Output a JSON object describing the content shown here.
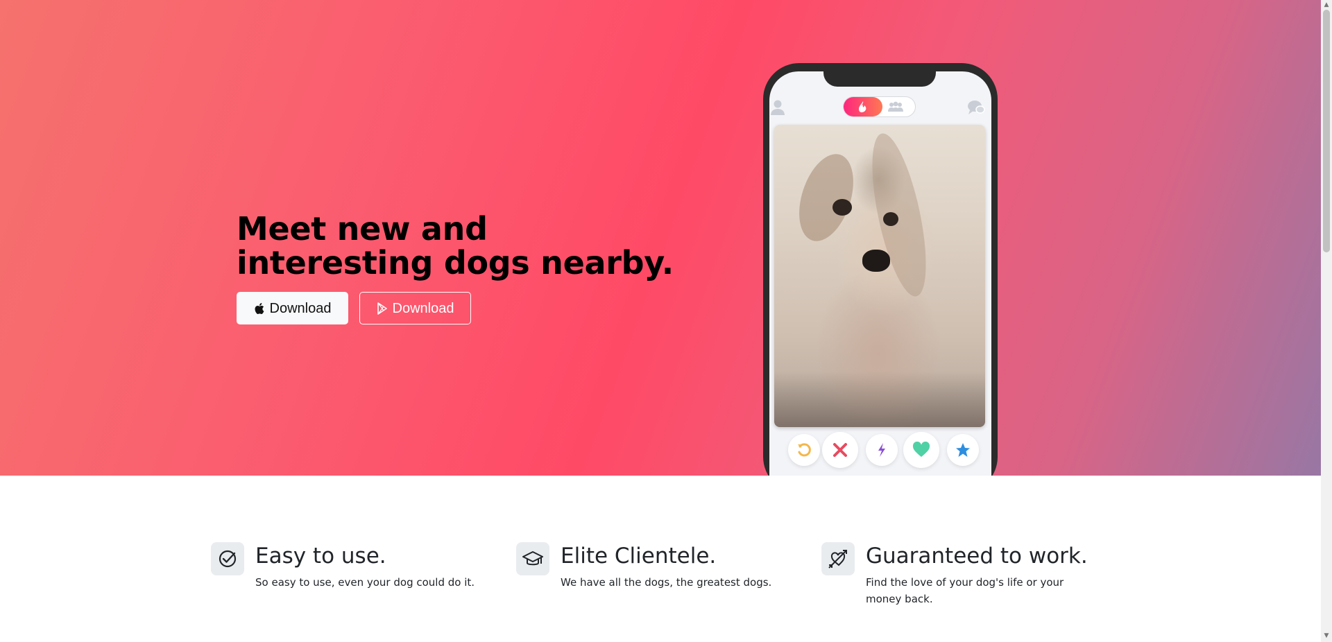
{
  "hero": {
    "title": "Meet new and interesting dogs nearby.",
    "buttons": {
      "apple_label": "Download",
      "play_label": "Download"
    }
  },
  "phone": {
    "actions": [
      "rewind-icon",
      "close-icon",
      "boost-icon",
      "heart-icon",
      "star-icon"
    ]
  },
  "features": [
    {
      "icon": "check-circle-icon",
      "title": "Easy to use.",
      "text": "So easy to use, even your dog could do it."
    },
    {
      "icon": "graduation-cap-icon",
      "title": "Elite Clientele.",
      "text": "We have all the dogs, the greatest dogs."
    },
    {
      "icon": "heart-arrow-icon",
      "title": "Guaranteed to work.",
      "text": "Find the love of your dog's life or your money back."
    }
  ],
  "colors": {
    "hero_start": "#f5726e",
    "hero_mid": "#ff4a66",
    "hero_end": "#9877a4",
    "toggle_accent": "#fd267d",
    "rewind": "#f5b748",
    "nope": "#e84a5f",
    "boost": "#8a4fd3",
    "like": "#4fd1a5",
    "superlike": "#2d8ee0"
  }
}
